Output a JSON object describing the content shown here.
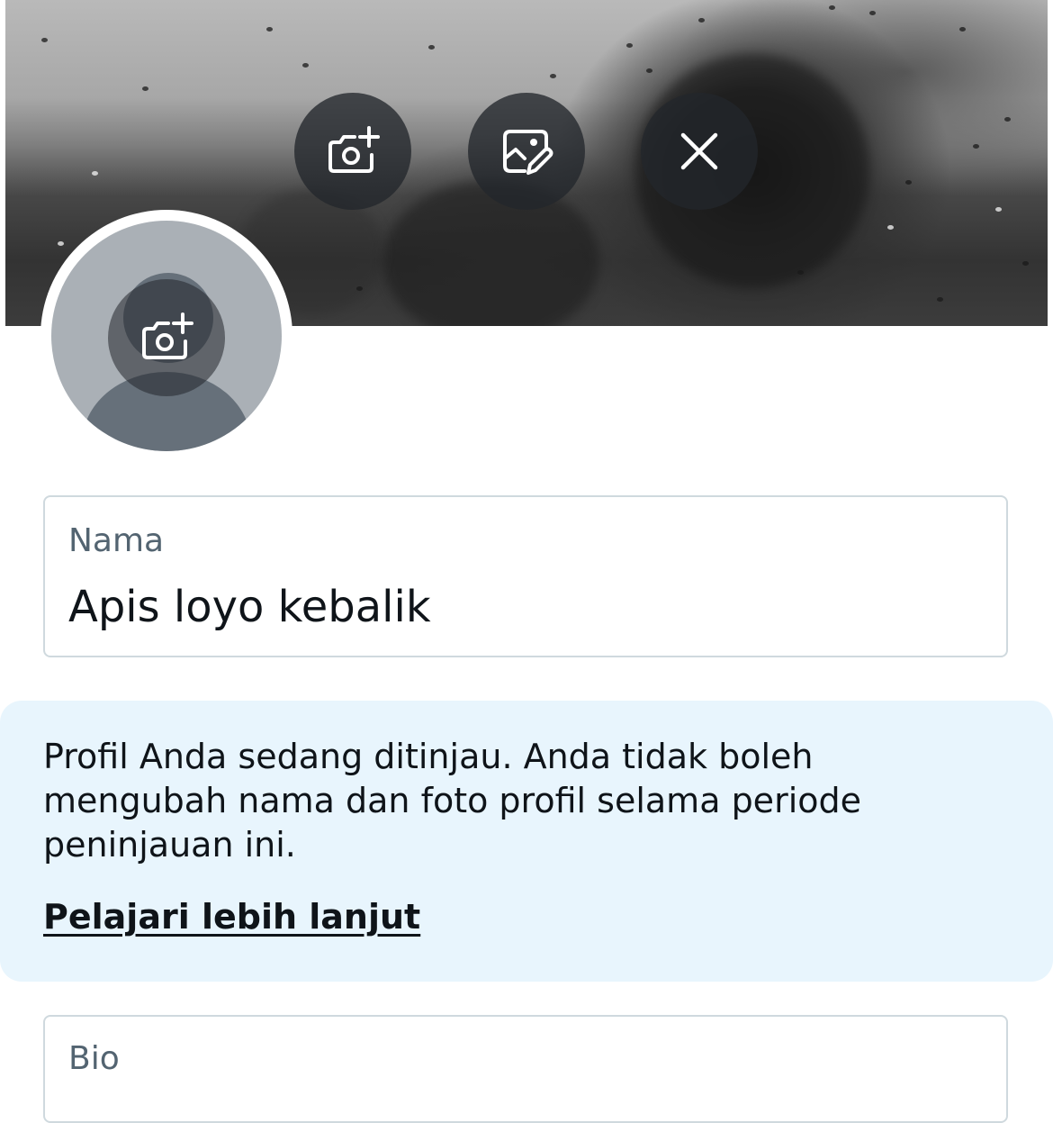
{
  "banner": {
    "add_photo_icon": "camera-plus-icon",
    "edit_photo_icon": "image-edit-icon",
    "remove_icon": "close-icon"
  },
  "avatar": {
    "add_photo_icon": "camera-plus-icon"
  },
  "name_field": {
    "label": "Nama",
    "value": "Apis loyo kebalik"
  },
  "notice": {
    "text": "Profil Anda sedang ditinjau. Anda tidak boleh mengubah nama dan foto profil selama periode peninjauan ini.",
    "link": "Pelajari lebih lanjut",
    "background": "#e8f5fd"
  },
  "bio_field": {
    "label": "Bio"
  },
  "colors": {
    "field_border": "#cfd9de",
    "label": "#536471",
    "text": "#0f1419"
  }
}
